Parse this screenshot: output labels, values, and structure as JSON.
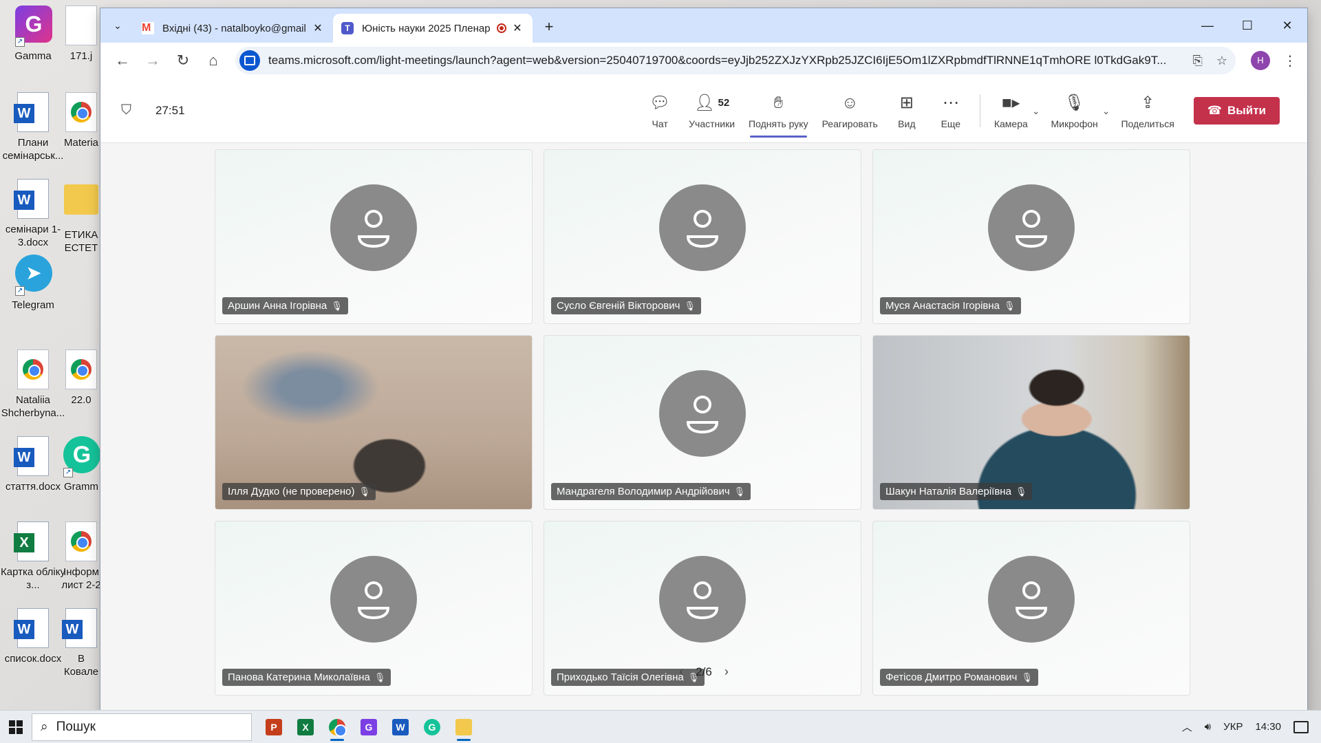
{
  "desktop": {
    "icons": [
      {
        "label": "Gamma"
      },
      {
        "label": "171.j"
      },
      {
        "label": "Плани семінарськ..."
      },
      {
        "label": "Materia"
      },
      {
        "label": "семінари 1-3.docx"
      },
      {
        "label": "ЕТИКА ЕСТЕТ"
      },
      {
        "label": "Telegram"
      },
      {
        "label": "Nataliia Shcherbyna..."
      },
      {
        "label": "22.0"
      },
      {
        "label": "стаття.docx"
      },
      {
        "label": "Gramm"
      },
      {
        "label": "Картка обліку з..."
      },
      {
        "label": "Інформ лист 2-2"
      },
      {
        "label": "список.docx"
      },
      {
        "label": "В Ковале"
      }
    ]
  },
  "browser": {
    "tabs": [
      {
        "title": "Вхідні (43) - natalboyko@gmail",
        "close": "✕"
      },
      {
        "title": "Юність науки 2025 Пленар",
        "close": "✕"
      }
    ],
    "new_tab": "+",
    "url": "teams.microsoft.com/light-meetings/launch?agent=web&version=25040719700&coords=eyJjb252ZXJzYXRpb25JZCI6IjE5Om1lZXRpbmdfTlRNNE1qTmhORE l0TkdGak9T...",
    "avatar_letter": "Н"
  },
  "meeting": {
    "timer": "27:51",
    "controls": {
      "chat": "Чат",
      "participants": "Участники",
      "participants_count": "52",
      "raise_hand": "Поднять руку",
      "react": "Реагировать",
      "view": "Вид",
      "more": "Еще",
      "camera": "Камера",
      "mic": "Микрофон",
      "share": "Поделиться",
      "leave": "Выйти"
    },
    "participants": [
      {
        "name": "Аршин Анна Ігорівна"
      },
      {
        "name": "Сусло Євгеній Вікторович"
      },
      {
        "name": "Муся Анастасія Ігорівна"
      },
      {
        "name": "Ілля Дудко (не проверено)"
      },
      {
        "name": "Мандрагеля Володимир Андрійович"
      },
      {
        "name": "Шакун Наталія Валеріївна"
      },
      {
        "name": "Панова Катерина Миколаївна"
      },
      {
        "name": "Приходько Таїсія Олегівна"
      },
      {
        "name": "Фетісов Дмитро Романович"
      }
    ],
    "pager": "2/6"
  },
  "taskbar": {
    "search_placeholder": "Пошук",
    "lang": "УКР",
    "time": "14:30"
  },
  "colors": {
    "teams_accent": "#5b5fc7",
    "leave_red": "#c4314b",
    "chrome_tabstrip": "#d3e3fd"
  }
}
